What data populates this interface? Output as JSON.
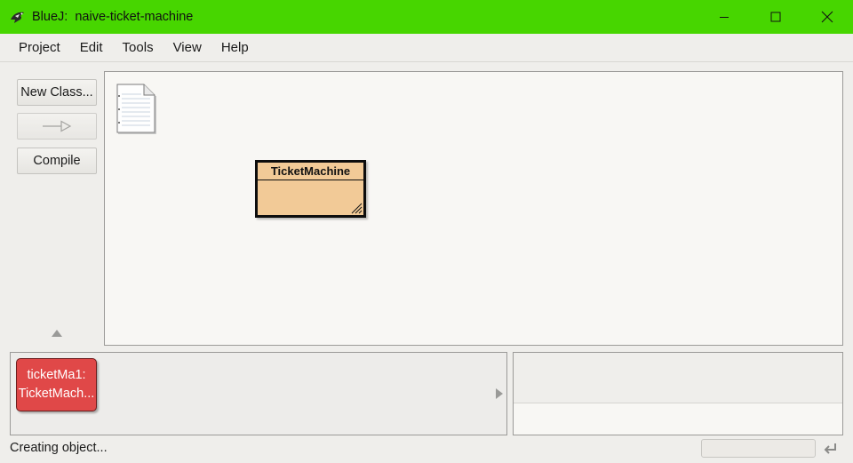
{
  "window": {
    "title": "BlueJ:  naive-ticket-machine",
    "icon": "bluej-bird-icon",
    "controls": [
      "minimize-icon",
      "maximize-icon",
      "close-icon"
    ]
  },
  "menu": {
    "items": [
      "Project",
      "Edit",
      "Tools",
      "View",
      "Help"
    ]
  },
  "tools": {
    "new_class_label": "New Class...",
    "inherit_arrow_icon": "inheritance-arrow-icon",
    "compile_label": "Compile"
  },
  "diagram": {
    "readme_icon": "readme-document-icon",
    "classes": [
      {
        "name": "TicketMachine"
      }
    ]
  },
  "bench": {
    "objects": [
      {
        "line1": "ticketMa1:",
        "line2": "TicketMach..."
      }
    ]
  },
  "status": {
    "text": "Creating object..."
  },
  "colors": {
    "titlebar": "#47d600",
    "class_fill": "#f2ca97",
    "object_fill": "#e04848"
  }
}
